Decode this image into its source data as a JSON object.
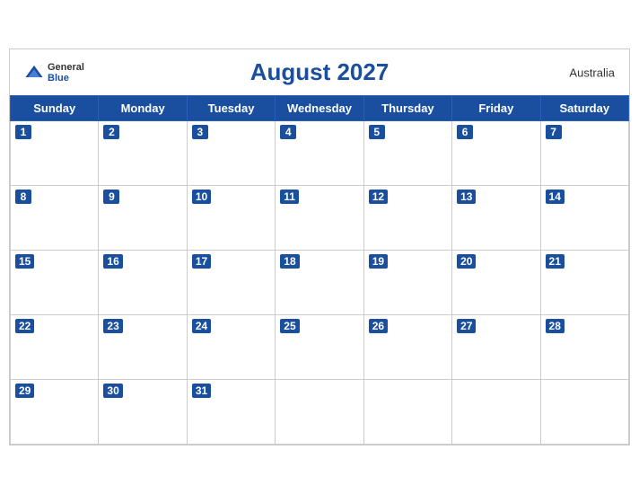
{
  "header": {
    "title": "August 2027",
    "country": "Australia",
    "logo_general": "General",
    "logo_blue": "Blue"
  },
  "weekdays": [
    "Sunday",
    "Monday",
    "Tuesday",
    "Wednesday",
    "Thursday",
    "Friday",
    "Saturday"
  ],
  "weeks": [
    [
      1,
      2,
      3,
      4,
      5,
      6,
      7
    ],
    [
      8,
      9,
      10,
      11,
      12,
      13,
      14
    ],
    [
      15,
      16,
      17,
      18,
      19,
      20,
      21
    ],
    [
      22,
      23,
      24,
      25,
      26,
      27,
      28
    ],
    [
      29,
      30,
      31,
      null,
      null,
      null,
      null
    ]
  ]
}
